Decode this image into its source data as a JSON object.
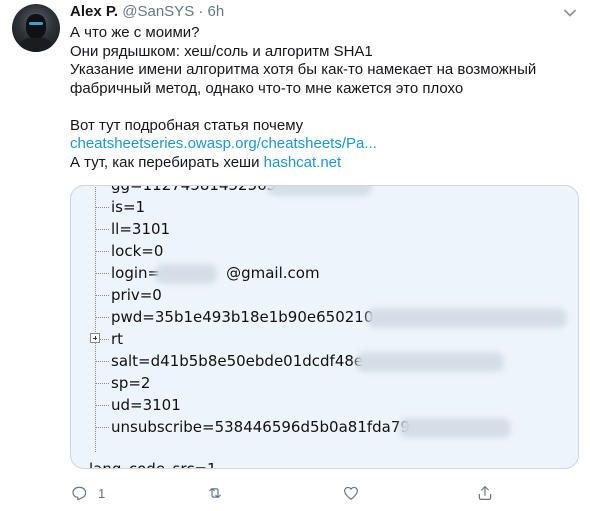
{
  "tweet": {
    "author_name": "Alex P.",
    "handle": "@SanSYS",
    "separator": "·",
    "time": "6h",
    "lines": [
      "А что же с моими?",
      "Они рядышком: хеш/соль и алгоритм SHA1",
      "Указание имени алгоритма хотя бы как-то намекает на возможный",
      "фабричный метод, однако что-то мне кажется это плохо",
      "",
      "Вот тут подробная статья почему"
    ],
    "link1": "cheatsheetseries.owasp.org/cheatsheets/Pa...",
    "line_last_prefix": "А тут, как перебирать хеши ",
    "link2": "hashcat.net"
  },
  "media": {
    "tree_items": [
      "gg=11274581452565",
      "is=1",
      "ll=3101",
      "lock=0",
      "login=",
      "priv=0",
      "pwd=35b1e493b18e1b90e650210",
      "rt",
      "salt=d41b5b8e50ebde01dcdf48e",
      "sp=2",
      "ud=3101",
      "unsubscribe=538446596d5b0a81fda79"
    ],
    "login_suffix": "@gmail.com",
    "last_line": "lang_code_src=1"
  },
  "actions": {
    "reply_count": "1",
    "retweet_count": "",
    "like_count": ""
  },
  "icons": [
    "reply-icon",
    "retweet-icon",
    "like-icon",
    "share-icon",
    "caret-down-icon"
  ],
  "colors": {
    "link": "#1b95e0",
    "muted": "#657786",
    "media_bg": "#eef4fb"
  }
}
